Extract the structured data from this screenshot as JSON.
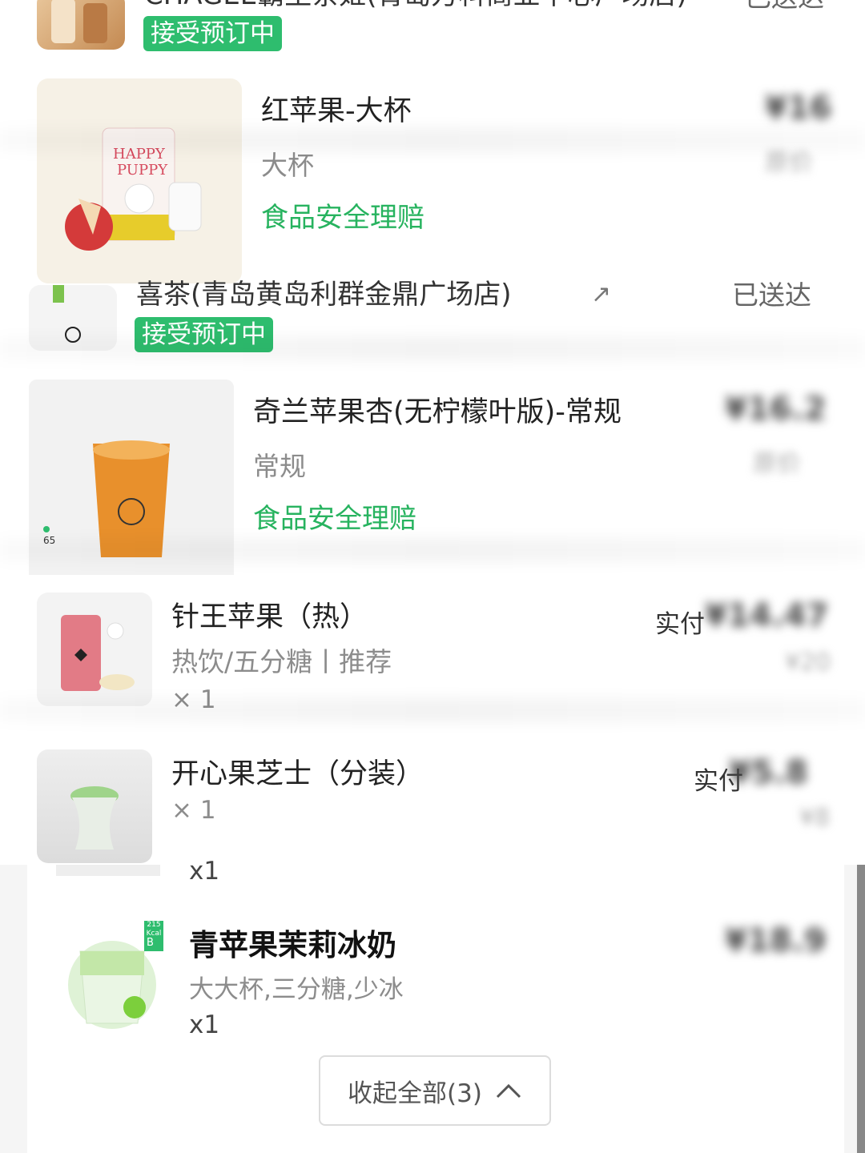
{
  "orders": [
    {
      "store": "CHAGEE霸王茶姬(青岛万科商业中心广场店)",
      "status": "已送达",
      "badge": "接受预订中"
    },
    {
      "store": "喜茶(青岛黄岛利群金鼎广场店)",
      "status": "已送达",
      "badge": "接受预订中"
    }
  ],
  "items": [
    {
      "name": "红苹果-大杯",
      "spec": "大杯",
      "guarantee": "食品安全理赔",
      "price": "¥16",
      "sub": "原价"
    },
    {
      "name": "奇兰苹果杏(无柠檬叶版)-常规",
      "spec": "常规",
      "guarantee": "食品安全理赔",
      "price": "¥16.2",
      "sub": "原价"
    },
    {
      "name": "针王苹果（热）",
      "spec": "热饮/五分糖丨推荐",
      "qty": "× 1",
      "paid_label": "实付",
      "price": "¥14.47",
      "sub": "¥20"
    },
    {
      "name": "开心果芝士（分装）",
      "qty": "× 1",
      "paid_label": "实付",
      "price": "¥5.8",
      "sub": "¥8"
    }
  ],
  "panel": {
    "prev_qty": "x1",
    "item": {
      "name": "青苹果茉莉冰奶",
      "spec": "大大杯,三分糖,少冰",
      "qty": "x1",
      "price": "¥18.9",
      "cal_badge": "215 Kcal",
      "grade": "B"
    },
    "collapse_label": "收起全部(3)"
  },
  "colors": {
    "green_badge": "#2ebd6e",
    "green_text": "#27b35f"
  }
}
